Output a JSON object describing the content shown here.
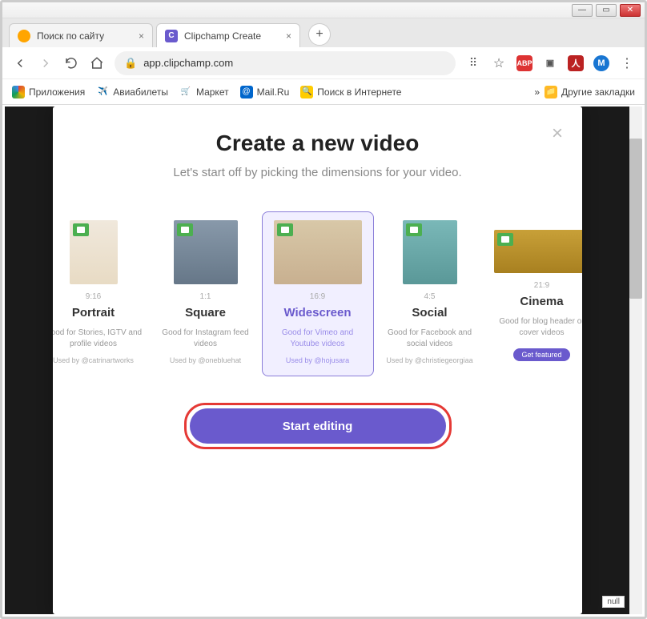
{
  "tabs": [
    {
      "title": "Поиск по сайту"
    },
    {
      "title": "Clipchamp Create"
    }
  ],
  "url": "app.clipchamp.com",
  "bookmarks": {
    "apps": "Приложения",
    "avia": "Авиабилеты",
    "market": "Маркет",
    "mail": "Mail.Ru",
    "search": "Поиск в Интернете",
    "other": "Другие закладки"
  },
  "modal": {
    "title": "Create a new video",
    "subtitle": "Let's start off by picking the dimensions for your video."
  },
  "dims": [
    {
      "ratio": "9:16",
      "name": "Portrait",
      "desc": "Good for Stories, IGTV and profile videos",
      "used": "Used by @catrinartworks"
    },
    {
      "ratio": "1:1",
      "name": "Square",
      "desc": "Good for Instagram feed videos",
      "used": "Used by @onebluehat"
    },
    {
      "ratio": "16:9",
      "name": "Widescreen",
      "desc": "Good for Vimeo and Youtube videos",
      "used": "Used by @hojusara"
    },
    {
      "ratio": "4:5",
      "name": "Social",
      "desc": "Good for Facebook and social videos",
      "used": "Used by @christiegeorgiaa"
    },
    {
      "ratio": "21:9",
      "name": "Cinema",
      "desc": "Good for blog header or cover videos",
      "used": "Get featured"
    }
  ],
  "start_label": "Start editing",
  "profile_initial": "M",
  "null_text": "null"
}
